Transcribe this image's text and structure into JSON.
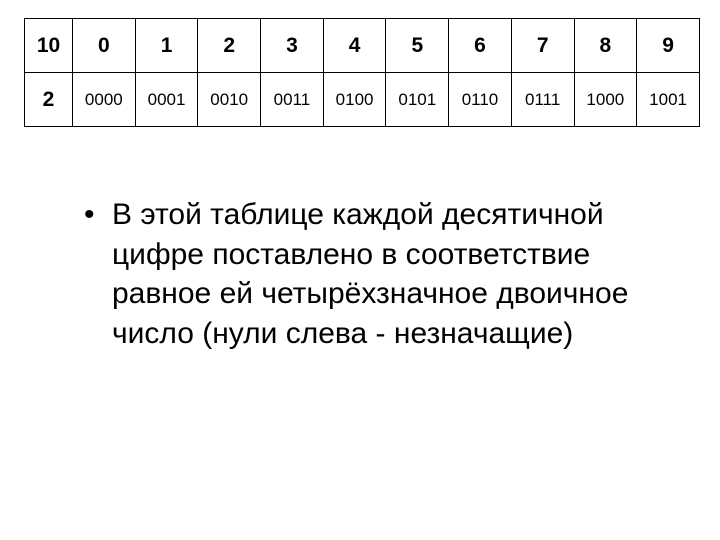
{
  "chart_data": {
    "type": "table",
    "title": "",
    "header_label": "10",
    "row_label": "2",
    "columns": [
      "0",
      "1",
      "2",
      "3",
      "4",
      "5",
      "6",
      "7",
      "8",
      "9"
    ],
    "values": [
      "0000",
      "0001",
      "0010",
      "0011",
      "0100",
      "0101",
      "0110",
      "0111",
      "1000",
      "1001"
    ]
  },
  "bullet_text": "В этой таблице каждой десятичной цифре поставлено в соответствие равное ей четырёхзначное двоичное число (нули слева - незначащие)"
}
